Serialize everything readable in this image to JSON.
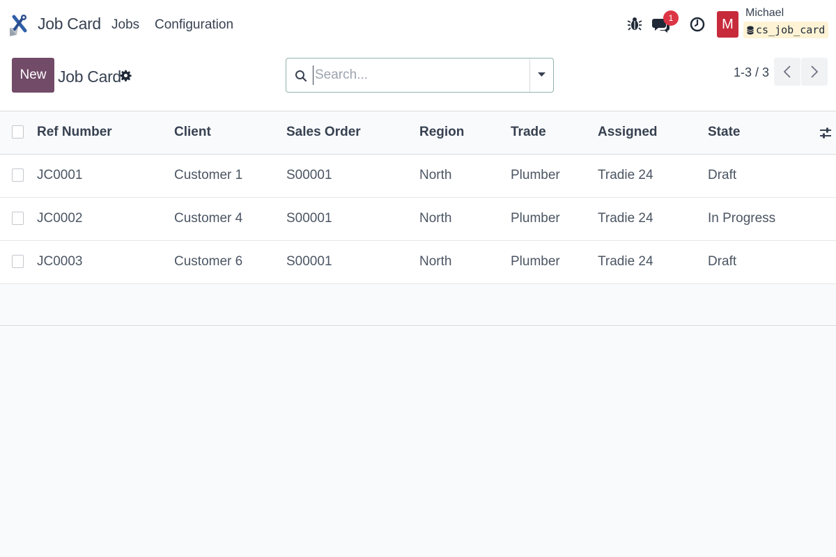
{
  "navbar": {
    "app_name": "Job Card",
    "menu": [
      "Jobs",
      "Configuration"
    ],
    "messages_badge": "1",
    "user": {
      "avatar_letter": "M",
      "name": "Michael",
      "database": "cs_job_card"
    }
  },
  "control_panel": {
    "new_label": "New",
    "title": "Job Card",
    "search_placeholder": "Search...",
    "pager_value": "1-3 / 3"
  },
  "table": {
    "columns": [
      "Ref Number",
      "Client",
      "Sales Order",
      "Region",
      "Trade",
      "Assigned",
      "State"
    ],
    "rows": [
      [
        "JC0001",
        "Customer 1",
        "S00001",
        "North",
        "Plumber",
        "Tradie 24",
        "Draft"
      ],
      [
        "JC0002",
        "Customer 4",
        "S00001",
        "North",
        "Plumber",
        "Tradie 24",
        "In Progress"
      ],
      [
        "JC0003",
        "Customer 6",
        "S00001",
        "North",
        "Plumber",
        "Tradie 24",
        "Draft"
      ]
    ]
  },
  "colors": {
    "primary": "#714b67",
    "badge": "#dc3545",
    "avatar": "#c72a3a",
    "db_chip_bg": "#fef3d4"
  },
  "icons": [
    "app-tools-icon",
    "bug-icon",
    "chat-icon",
    "clock-icon",
    "gear-icon",
    "search-icon",
    "caret-down-icon",
    "chevron-left-icon",
    "chevron-right-icon",
    "database-icon",
    "column-settings-icon"
  ]
}
